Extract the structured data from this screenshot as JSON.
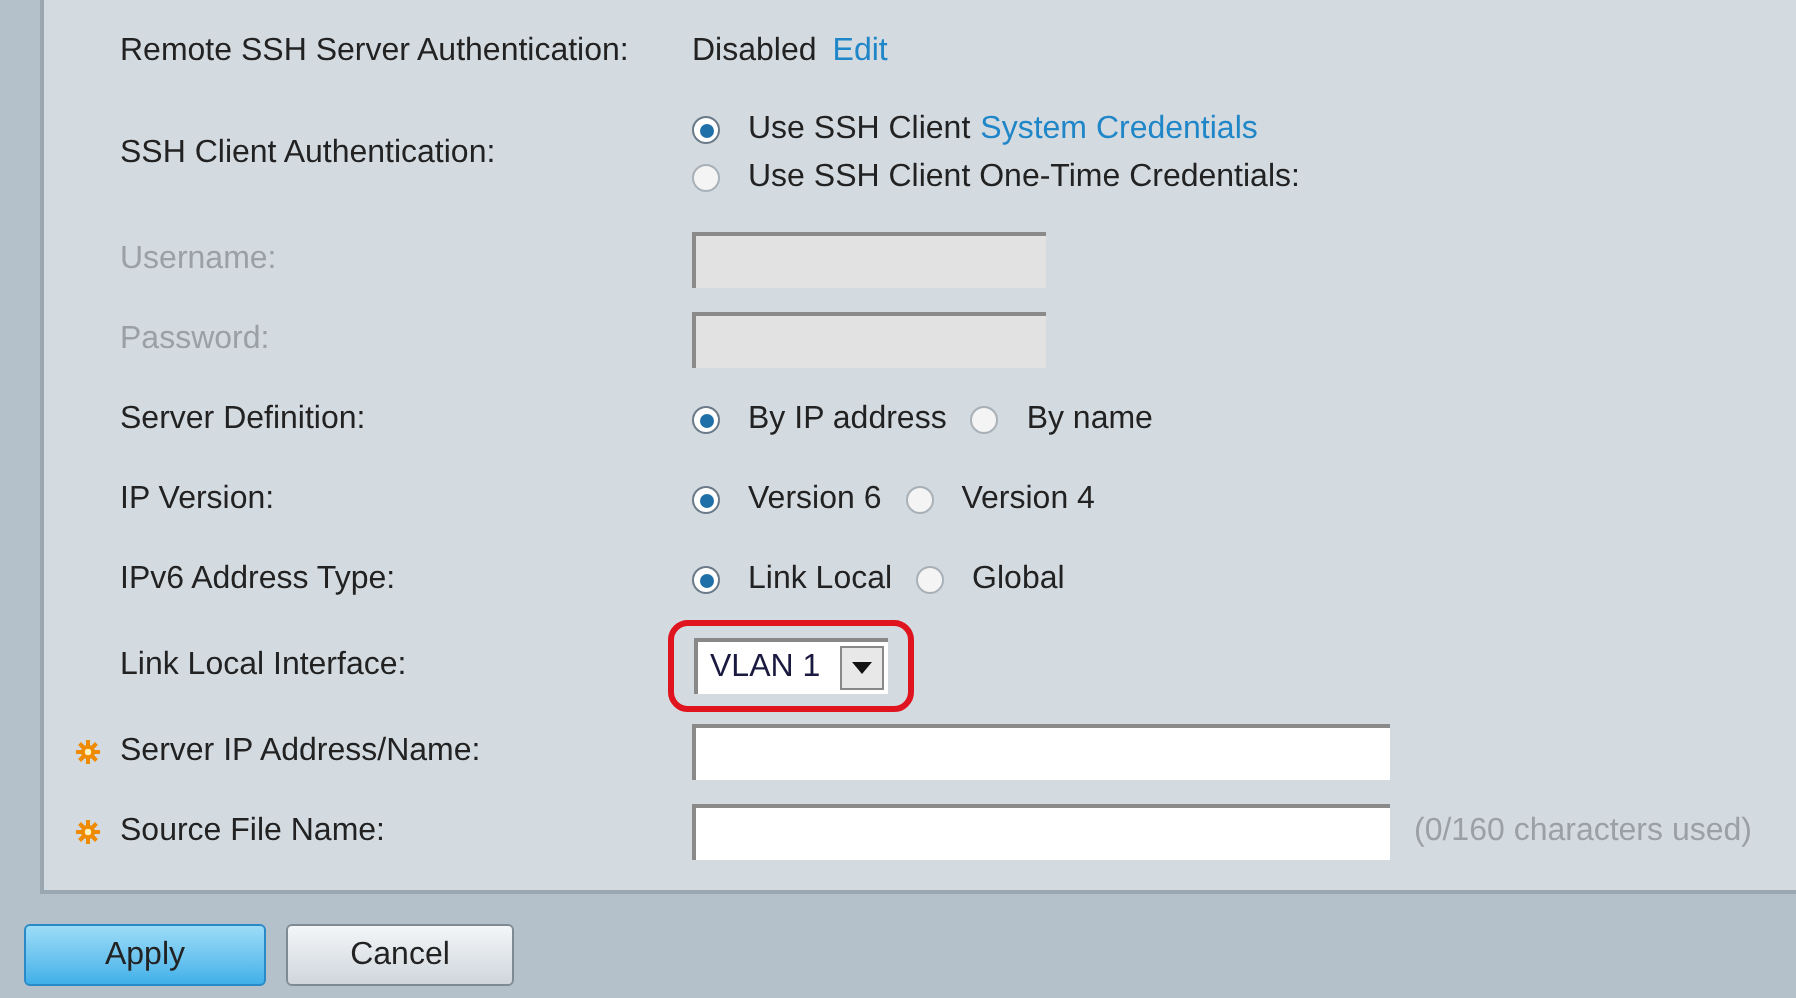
{
  "rows": [
    {
      "kind": "status",
      "label": "Remote SSH Server Authentication:",
      "value": "Disabled",
      "link": "Edit"
    },
    {
      "kind": "radio_stack",
      "label": "SSH Client Authentication:",
      "options": [
        {
          "label": "Use SSH Client",
          "link": "System Credentials",
          "selected": true
        },
        {
          "label": "Use SSH Client One-Time Credentials:",
          "selected": false
        }
      ]
    },
    {
      "kind": "input",
      "label": "Username:",
      "disabled": true,
      "wide": false,
      "required": false
    },
    {
      "kind": "input",
      "label": "Password:",
      "disabled": true,
      "wide": false,
      "required": false
    },
    {
      "kind": "radio_row",
      "label": "Server Definition:",
      "options": [
        {
          "label": "By IP address",
          "selected": true
        },
        {
          "label": "By name",
          "selected": false
        }
      ]
    },
    {
      "kind": "radio_row",
      "label": "IP Version:",
      "options": [
        {
          "label": "Version 6",
          "selected": true
        },
        {
          "label": "Version 4",
          "selected": false
        }
      ]
    },
    {
      "kind": "radio_row",
      "label": "IPv6 Address Type:",
      "options": [
        {
          "label": "Link Local",
          "selected": true
        },
        {
          "label": "Global",
          "selected": false
        }
      ]
    },
    {
      "kind": "select",
      "label": "Link Local Interface:",
      "value": "VLAN 1",
      "highlighted": true
    },
    {
      "kind": "input",
      "label": "Server IP Address/Name:",
      "disabled": false,
      "wide": true,
      "required": true
    },
    {
      "kind": "input",
      "label": "Source File Name:",
      "disabled": false,
      "wide": true,
      "required": true,
      "note": "(0/160 characters used)"
    }
  ],
  "buttons": [
    {
      "label": "Apply",
      "primary": true
    },
    {
      "label": "Cancel",
      "primary": false
    }
  ]
}
